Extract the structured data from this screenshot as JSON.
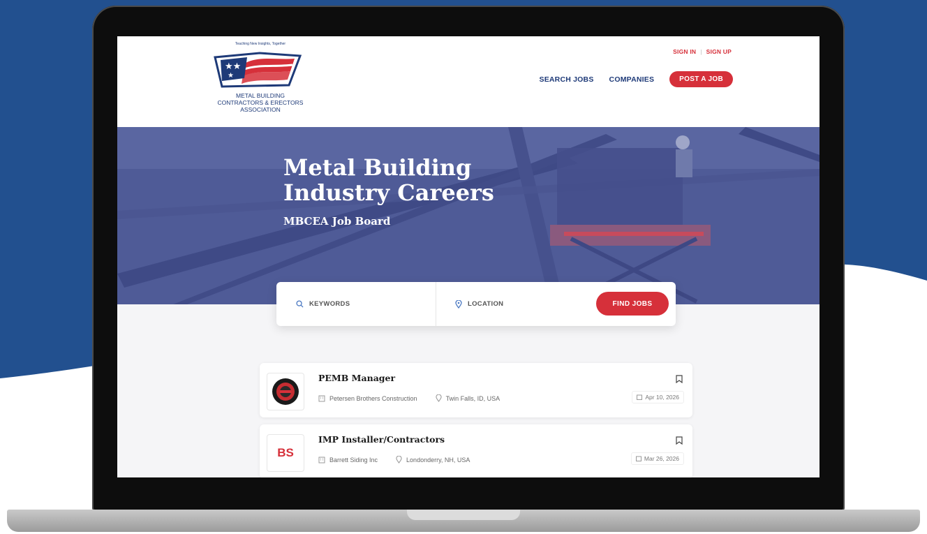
{
  "colors": {
    "brand_red": "#d6303a",
    "navy": "#1e3a78",
    "hero_overlay": "#4f5b97",
    "page_bg_blue": "#22508f"
  },
  "header": {
    "logo": {
      "tagline": "Teaching New Insights, Together",
      "line1": "METAL BUILDING",
      "line2": "CONTRACTORS & ERECTORS",
      "line3": "ASSOCIATION"
    },
    "auth": {
      "sign_in": "SIGN IN",
      "separator": "|",
      "sign_up": "SIGN UP"
    },
    "nav": {
      "search_jobs": "SEARCH JOBS",
      "companies": "COMPANIES",
      "post_job": "POST A JOB"
    }
  },
  "hero": {
    "title": "Metal Building Industry Careers",
    "subtitle": "MBCEA Job Board"
  },
  "search": {
    "keywords_placeholder": "KEYWORDS",
    "location_placeholder": "LOCATION",
    "find_button": "FIND JOBS",
    "keywords_icon": "search-icon",
    "location_icon": "location-pin-icon"
  },
  "jobs": [
    {
      "title": "PEMB Manager",
      "company": "Petersen Brothers Construction",
      "location": "Twin Falls, ID, USA",
      "date": "Apr 10, 2026",
      "logo_text": ""
    },
    {
      "title": "IMP Installer/Contractors",
      "company": "Barrett Siding Inc",
      "location": "Londonderry, NH, USA",
      "date": "Mar 26, 2026",
      "logo_text": "BS"
    }
  ]
}
